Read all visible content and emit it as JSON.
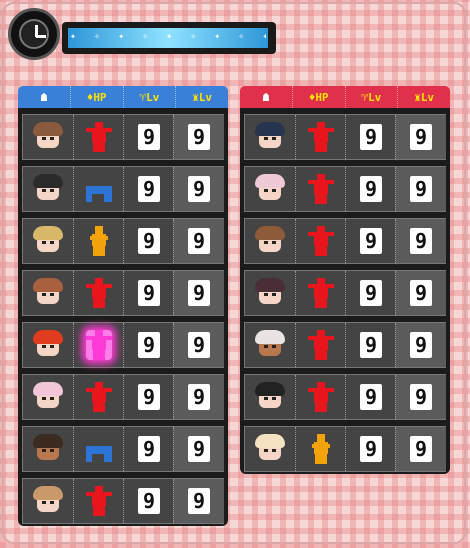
{
  "header": {
    "clock_icon": "clock-icon",
    "gauge_decoration": "✦ ✧ ✦ ✧ ✦ ✧ ✦ ✧ ✦ ✧ ✦",
    "gauge_color": "#8fe3ff"
  },
  "left_team": {
    "header": {
      "icon": "monokuma-icon",
      "hp": "HP",
      "lv_a": "Lv",
      "lv_b": "Lv"
    },
    "color": "#3a7fd8",
    "rows": [
      {
        "face": "brown-hair",
        "hp_state": "healthy",
        "hp_color": "#e8151c",
        "lv_a": "9",
        "lv_b": "9"
      },
      {
        "face": "dark-hair",
        "hp_state": "down",
        "hp_color": "#2c74d6",
        "lv_a": "9",
        "lv_b": "9"
      },
      {
        "face": "blond-glasses",
        "hp_state": "standing",
        "hp_color": "#f3a30a",
        "lv_a": "9",
        "lv_b": "9"
      },
      {
        "face": "brown-glasses",
        "hp_state": "healthy",
        "hp_color": "#e8151c",
        "lv_a": "9",
        "lv_b": "9"
      },
      {
        "face": "red-spiky",
        "hp_state": "boosted",
        "hp_color": "#ff3ad6",
        "lv_a": "9",
        "lv_b": "9"
      },
      {
        "face": "hat-glasses",
        "hp_state": "healthy",
        "hp_color": "#e8151c",
        "lv_a": "9",
        "lv_b": "9"
      },
      {
        "face": "dreadlocks",
        "hp_state": "down",
        "hp_color": "#2c74d6",
        "lv_a": "9",
        "lv_b": "9"
      },
      {
        "face": "light-brown",
        "hp_state": "healthy",
        "hp_color": "#e8151c",
        "lv_a": "9",
        "lv_b": "9"
      }
    ]
  },
  "right_team": {
    "header": {
      "icon": "monokuma-icon",
      "hp": "HP",
      "lv_a": "Lv",
      "lv_b": "Lv"
    },
    "color": "#e0304c",
    "rows": [
      {
        "face": "dark-blue-hair",
        "hp_state": "healthy",
        "hp_color": "#e8151c",
        "lv_a": "9",
        "lv_b": "9"
      },
      {
        "face": "pink-hair",
        "hp_state": "healthy",
        "hp_color": "#e8151c",
        "lv_a": "9",
        "lv_b": "9"
      },
      {
        "face": "brown-bun",
        "hp_state": "healthy",
        "hp_color": "#e8151c",
        "lv_a": "9",
        "lv_b": "9"
      },
      {
        "face": "purple-glasses",
        "hp_state": "healthy",
        "hp_color": "#e8151c",
        "lv_a": "9",
        "lv_b": "9"
      },
      {
        "face": "white-hair-tan",
        "hp_state": "healthy",
        "hp_color": "#e8151c",
        "lv_a": "9",
        "lv_b": "9"
      },
      {
        "face": "maid-headband",
        "hp_state": "healthy",
        "hp_color": "#e8151c",
        "lv_a": "9",
        "lv_b": "9"
      },
      {
        "face": "blonde-pigtails",
        "hp_state": "standing",
        "hp_color": "#f3a30a",
        "lv_a": "9",
        "lv_b": "9"
      }
    ]
  }
}
